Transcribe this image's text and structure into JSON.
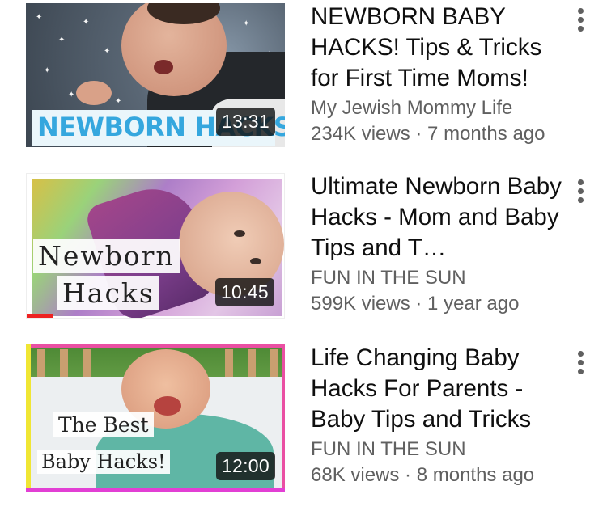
{
  "videos": [
    {
      "title": "NEWBORN BABY HACKS! Tips & Tricks for First Time Moms!",
      "channel": "My Jewish Mommy Life",
      "meta": "234K views · 7 months ago",
      "duration": "13:31",
      "thumb_text": [
        "NEWBORN HACKS"
      ],
      "watched_fraction": 0
    },
    {
      "title": "Ultimate Newborn Baby Hacks - Mom and Baby Tips and T…",
      "channel": "FUN IN THE SUN",
      "meta": "599K views · 1 year ago",
      "duration": "10:45",
      "thumb_text": [
        "Newborn",
        "Hacks"
      ],
      "watched_fraction": 0.1
    },
    {
      "title": "Life Changing Baby Hacks For Parents - Baby Tips and Tricks",
      "channel": "FUN IN THE SUN",
      "meta": "68K views · 8 months ago",
      "duration": "12:00",
      "thumb_text": [
        "The Best",
        "Baby Hacks!"
      ],
      "watched_fraction": 0
    }
  ],
  "colors": {
    "text_primary": "#0f0f0f",
    "text_secondary": "#606060",
    "progress_bar": "#e22222"
  },
  "icons": {
    "more": "vertical-ellipsis"
  }
}
